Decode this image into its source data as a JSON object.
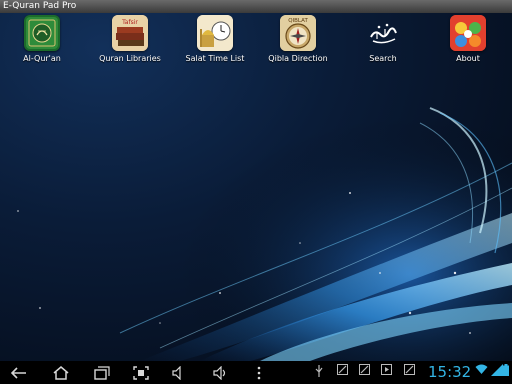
{
  "window": {
    "title": "E-Quran Pad Pro"
  },
  "apps": [
    {
      "label": "Al-Qur'an",
      "icon": "quran-book-icon"
    },
    {
      "label": "Quran Libraries",
      "icon": "tafsir-books-icon",
      "badge": "Tafsir"
    },
    {
      "label": "Salat Time List",
      "icon": "mosque-clock-icon"
    },
    {
      "label": "Qibla Direction",
      "icon": "qibla-compass-icon",
      "badge": "QIBLAT"
    },
    {
      "label": "Search",
      "icon": "calligraphy-search-icon"
    },
    {
      "label": "About",
      "icon": "about-info-icon"
    }
  ],
  "system_bar": {
    "clock": "15:32",
    "accent_color": "#33b5e5"
  }
}
